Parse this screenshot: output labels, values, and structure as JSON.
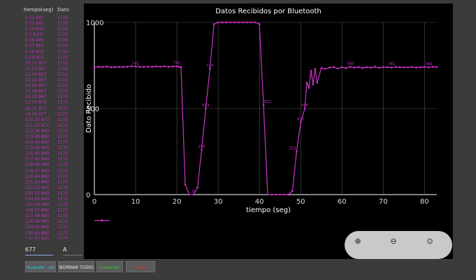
{
  "table": {
    "header_time": "tiempo(seg)",
    "header_value": "Dato",
    "rows": [
      [
        "0.11 841",
        "1150"
      ],
      [
        "0.13 841",
        "1150"
      ],
      [
        "0.14 841",
        "1150"
      ],
      [
        "0.1 8.45",
        "1150"
      ],
      [
        "0.16 845",
        "1150"
      ],
      [
        "0.17 857",
        "1150"
      ],
      [
        "0.18 857",
        "1150"
      ],
      [
        "0.19 857",
        "1150"
      ],
      [
        "10.21 857",
        "1152"
      ],
      [
        "11.23 857",
        "1152"
      ],
      [
        "12.24 867",
        "1152"
      ],
      [
        "13.25 867",
        "1152"
      ],
      [
        "14.26 867",
        "1152"
      ],
      [
        "15.28 867",
        "1172"
      ],
      [
        "16.29 867",
        "1172"
      ],
      [
        "17.30 874",
        "1172"
      ],
      [
        "18.31 877",
        "1172"
      ],
      [
        "19.33 877",
        "1172"
      ],
      [
        "110.35 877",
        "1172"
      ],
      [
        "111.37 877",
        "1172"
      ],
      [
        "112.38 880",
        "1172"
      ],
      [
        "113.39 880",
        "1172"
      ],
      [
        "114.41 880",
        "1172"
      ],
      [
        "115.42 880",
        "1172"
      ],
      [
        "116.43 880",
        "1172"
      ],
      [
        "117.45 880",
        "1172"
      ],
      [
        "118.46 880",
        "1172"
      ],
      [
        "119.47 880",
        "1172"
      ],
      [
        "120.49 880",
        "1172"
      ],
      [
        "121.50 880",
        "1172"
      ],
      [
        "122.52 880",
        "1172"
      ],
      [
        "123.53 880",
        "1172"
      ],
      [
        "124.54 880",
        "1172"
      ],
      [
        "125.56 880",
        "1172"
      ],
      [
        "126.57 880",
        "1172"
      ],
      [
        "127.58 880",
        "1172"
      ],
      [
        "128.59 880",
        "1172"
      ],
      [
        "129.61 880",
        "1172"
      ],
      [
        "130.62 880",
        "1172"
      ],
      [
        "131.63 880",
        "1172"
      ],
      [
        "132.65 880",
        "1172"
      ],
      [
        "133.66 880",
        "1172"
      ],
      [
        "134.67 880",
        "1172"
      ],
      [
        "135.69 880",
        "1172"
      ],
      [
        "136.70 880",
        "1172"
      ],
      [
        "137.71 880",
        "1172"
      ],
      [
        "138.73 880",
        "1172"
      ],
      [
        "139.74 880",
        "1172"
      ]
    ]
  },
  "inputs": {
    "value": "677",
    "char": "A"
  },
  "buttons": {
    "save_label": "Guardar .xls",
    "clear_label": "BORRAR TODO",
    "connect_label": "Conectar",
    "exit_label": "Salir"
  },
  "colors": {
    "series": "#cc33cc",
    "save": "#33ccee",
    "connect": "#33cc33",
    "exit": "#ee3333",
    "chart_bg": "#000000",
    "axis": "#ffffff",
    "grid": "#555555"
  },
  "zoom": {
    "zoom_in_icon": "zoom-in-icon",
    "zoom_out_icon": "zoom-out-icon",
    "zoom_reset_icon": "zoom-reset-icon"
  },
  "chart_data": {
    "type": "line",
    "title": "Datos Recibidos por Bluetooth",
    "xlabel": "tiempo (seg)",
    "ylabel": "Dato Recibido",
    "xlim": [
      0,
      83
    ],
    "ylim": [
      0,
      1000
    ],
    "x_ticks": [
      0,
      10,
      20,
      30,
      40,
      50,
      60,
      70,
      80
    ],
    "y_ticks": [
      0,
      500,
      1000
    ],
    "grid": true,
    "legend": "bottom-left",
    "series": [
      {
        "name": "",
        "x": [
          0,
          1,
          2,
          3,
          4,
          5,
          6,
          7,
          8,
          9,
          10,
          11,
          12,
          13,
          14,
          15,
          16,
          17,
          18,
          19,
          20,
          20.5,
          21,
          22,
          23,
          24,
          25,
          26,
          27,
          28,
          29,
          30,
          31,
          32,
          33,
          34,
          35,
          36,
          37,
          38,
          39,
          40,
          41,
          42,
          43,
          44,
          45,
          46,
          47,
          48,
          49,
          50,
          51,
          51.5,
          52,
          52.5,
          53,
          53.5,
          54,
          55,
          56,
          57,
          58,
          59,
          60,
          61,
          62,
          63,
          64,
          65,
          66,
          67,
          68,
          69,
          70,
          71,
          72,
          73,
          74,
          75,
          76,
          77,
          78,
          79,
          80,
          81,
          82,
          83
        ],
        "y": [
          740,
          742,
          741,
          743,
          739,
          740,
          742,
          741,
          743,
          745,
          744,
          742,
          741,
          743,
          742,
          744,
          743,
          745,
          742,
          744,
          745,
          742,
          740,
          60,
          0,
          0,
          40,
          260,
          500,
          730,
          990,
          1000,
          1000,
          1000,
          1000,
          1000,
          1000,
          1000,
          1000,
          1000,
          1000,
          990,
          520,
          0,
          0,
          0,
          0,
          0,
          0,
          20,
          250,
          420,
          500,
          650,
          620,
          720,
          640,
          730,
          650,
          735,
          730,
          738,
          740,
          732,
          740,
          735,
          742,
          738,
          741,
          735,
          740,
          738,
          742,
          736,
          740,
          740,
          738,
          741,
          740,
          739,
          740,
          741,
          738,
          740,
          741,
          739,
          742,
          740
        ]
      }
    ],
    "point_labels": [
      {
        "x": 10,
        "y": 741,
        "text": "741"
      },
      {
        "x": 20,
        "y": 745,
        "text": "745"
      },
      {
        "x": 24,
        "y": 0,
        "text": "0"
      },
      {
        "x": 26,
        "y": 260,
        "text": "255"
      },
      {
        "x": 27,
        "y": 500,
        "text": "513"
      },
      {
        "x": 28,
        "y": 730,
        "text": "730"
      },
      {
        "x": 42,
        "y": 520,
        "text": "521"
      },
      {
        "x": 48,
        "y": 250,
        "text": "253"
      },
      {
        "x": 50,
        "y": 420,
        "text": "415"
      },
      {
        "x": 51,
        "y": 500,
        "text": "500"
      },
      {
        "x": 62,
        "y": 742,
        "text": "740"
      },
      {
        "x": 72,
        "y": 740,
        "text": "741"
      },
      {
        "x": 81,
        "y": 740,
        "text": "740"
      }
    ]
  }
}
